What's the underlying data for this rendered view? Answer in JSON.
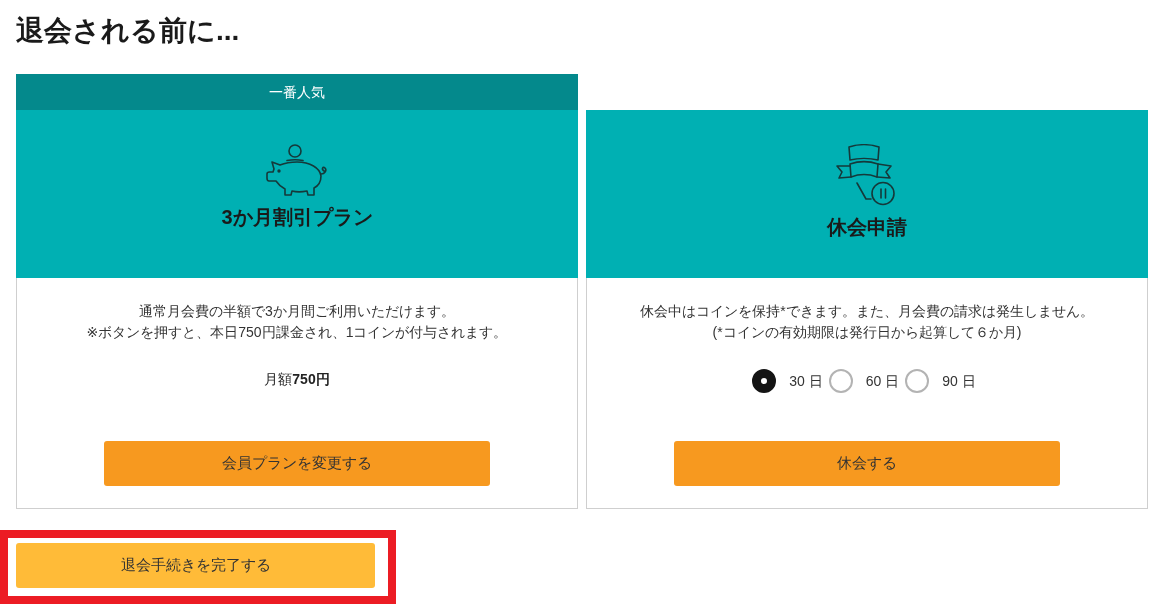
{
  "page": {
    "title": "退会される前に..."
  },
  "options": [
    {
      "kind": "plan",
      "badge": "一番人気",
      "title": "3か月割引プラン",
      "description": [
        "通常月会費の半額で3か月間ご利用いただけます。",
        "※ボタンを押すと、本日750円課金され、1コインが付与されます。"
      ],
      "price": "月額**750円**",
      "button": "会員プランを変更する"
    },
    {
      "kind": "pause",
      "title": "休会申請",
      "description": [
        "休会中はコインを保持*できます。また、月会費の請求は発生しません。",
        "(*コインの有効期限は発行日から起算して６か月)"
      ],
      "durations": [
        {
          "label": "30 日",
          "selected": true
        },
        {
          "label": "60 日",
          "selected": false
        },
        {
          "label": "90 日",
          "selected": false
        }
      ],
      "button": "休会する"
    }
  ],
  "complete_button": {
    "label": "退会手続きを完了する",
    "highlighted": true
  }
}
